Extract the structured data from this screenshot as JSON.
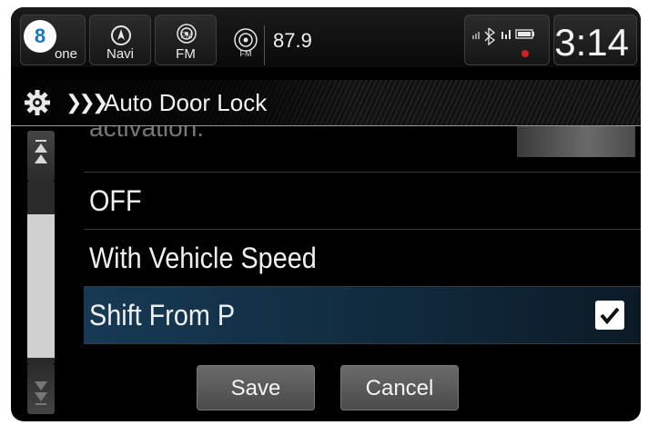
{
  "badge": "8",
  "topbar": {
    "phone_label": "one",
    "navi_label": "Navi",
    "fm_label": "FM",
    "fm_icon_text": "FM",
    "audio_icon_text": "FM",
    "frequency": "87.9",
    "clock": "3:14"
  },
  "header": {
    "breadcrumb_arrows": "❯❯❯",
    "title": "Auto Door Lock"
  },
  "list": {
    "cut_text": "activation.",
    "items": [
      {
        "label": "OFF",
        "selected": false
      },
      {
        "label": "With Vehicle Speed",
        "selected": false
      },
      {
        "label": "Shift From P",
        "selected": true
      }
    ]
  },
  "buttons": {
    "save": "Save",
    "cancel": "Cancel"
  },
  "icons": {
    "gear": "gear-icon",
    "navi": "compass-icon",
    "fm": "radio-icon",
    "bluetooth": "bluetooth-icon",
    "signal": "signal-icon",
    "battery": "battery-icon",
    "check": "check-icon"
  },
  "colors": {
    "selected_row": "#163a55",
    "badge_text": "#1a73c8"
  }
}
